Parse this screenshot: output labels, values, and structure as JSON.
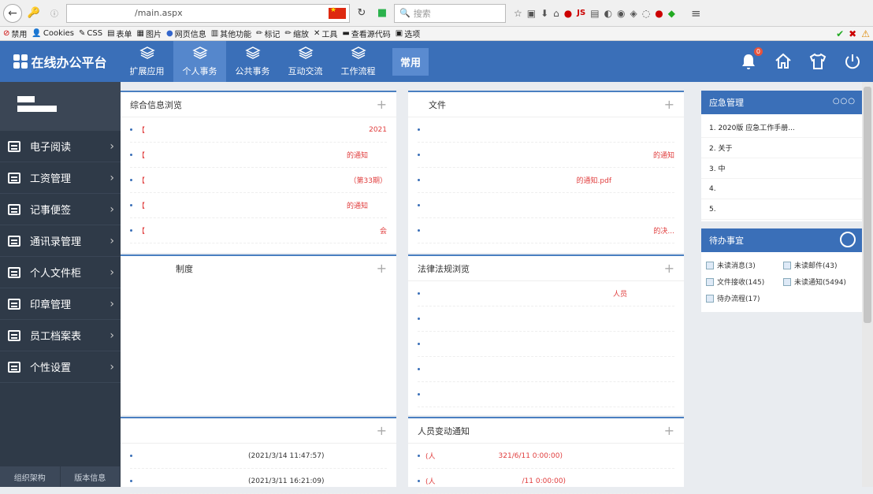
{
  "browser": {
    "url": "/main.aspx",
    "search_placeholder": "搜索",
    "bookmarks": [
      "禁用",
      "Cookies",
      "CSS",
      "表单",
      "图片",
      "网页信息",
      "其他功能",
      "标记",
      "缩放",
      "工具",
      "查看源代码",
      "选项"
    ]
  },
  "app": {
    "title": "在线办公平台",
    "nav": [
      {
        "label": "扩展应用",
        "active": false
      },
      {
        "label": "个人事务",
        "active": true
      },
      {
        "label": "公共事务",
        "active": false
      },
      {
        "label": "互动交流",
        "active": false
      },
      {
        "label": "工作流程",
        "active": false
      }
    ],
    "changyong": "常用",
    "bell_badge": "0"
  },
  "sidebar": {
    "items": [
      "电子阅读",
      "工资管理",
      "记事便签",
      "通讯录管理",
      "个人文件柜",
      "印章管理",
      "员工档案表",
      "个性设置"
    ],
    "bottom": [
      "组织架构",
      "版本信息"
    ]
  },
  "panels": {
    "info": {
      "title": "综合信息浏览",
      "items": [
        "【",
        "【",
        "【",
        "【",
        "【"
      ],
      "item_suffixes": [
        "2021",
        "的通知",
        "（第33期）",
        "的通知",
        "会"
      ]
    },
    "files": {
      "title": "文件",
      "items": [
        "",
        "",
        "",
        "",
        ""
      ],
      "item_suffixes": [
        "",
        "的通知",
        "的通知.pdf",
        "",
        "的决..."
      ]
    },
    "system": {
      "title": "制度",
      "items": []
    },
    "law": {
      "title": "法律法规浏览",
      "items": [
        "",
        "",
        "",
        "",
        ""
      ],
      "item_suffixes": [
        "人员",
        "",
        "",
        "",
        ""
      ]
    },
    "notice": {
      "title": "",
      "items": [
        "(2021/3/14 11:47:57)",
        "(2021/3/11 16:21:09)"
      ]
    },
    "personnel": {
      "title": "人员变动通知",
      "items": [
        "(人",
        "(人"
      ],
      "item_suffixes": [
        "321/6/11 0:00:00)",
        "/11 0:00:00)"
      ]
    }
  },
  "right": {
    "emergency": {
      "title": "应急管理",
      "items": [
        "1. 2020版 应急工作手册...",
        "2. 关于",
        "3. 中",
        "4.",
        "5."
      ]
    },
    "todo": {
      "title": "待办事宜",
      "items": [
        "未读消息(3)",
        "未读邮件(43)",
        "文件接收(145)",
        "未读通知(5494)",
        "待办流程(17)"
      ]
    }
  },
  "colors": {
    "primary": "#3a6fb8",
    "sidebar": "#2f3a48",
    "red_text": "#e03c3c"
  }
}
